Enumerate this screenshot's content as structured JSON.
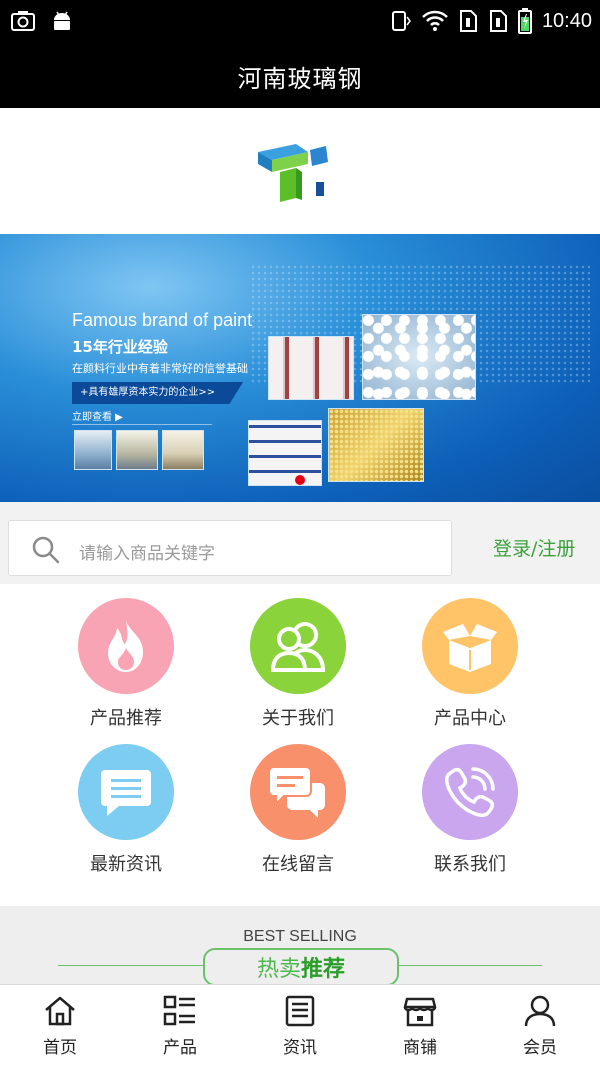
{
  "status_bar": {
    "time": "10:40"
  },
  "header": {
    "title": "河南玻璃钢"
  },
  "banner": {
    "title": "Famous brand of paint",
    "subtitle": "15年行业经验",
    "line": "在颜料行业中有着非常好的信誉基础",
    "pill": "+具有雄厚资本实力的企业>>",
    "more": "立即查看 ▶"
  },
  "search": {
    "placeholder": "请输入商品关键字",
    "login_label": "登录/注册"
  },
  "menu": [
    {
      "label": "产品推荐",
      "icon": "fire-icon",
      "color": "#f9a4b4"
    },
    {
      "label": "关于我们",
      "icon": "users-icon",
      "color": "#8ad33a"
    },
    {
      "label": "产品中心",
      "icon": "box-icon",
      "color": "#ffc468"
    },
    {
      "label": "最新资讯",
      "icon": "message-icon",
      "color": "#7dcdf2"
    },
    {
      "label": "在线留言",
      "icon": "chat-icon",
      "color": "#f7906b"
    },
    {
      "label": "联系我们",
      "icon": "phone-icon",
      "color": "#c9a6ee"
    }
  ],
  "best_selling": {
    "en": "BEST SELLING",
    "cn_part1": "热卖",
    "cn_part2": "推荐"
  },
  "tabbar": [
    {
      "label": "首页",
      "icon": "home-icon"
    },
    {
      "label": "产品",
      "icon": "list-icon"
    },
    {
      "label": "资讯",
      "icon": "news-icon"
    },
    {
      "label": "商铺",
      "icon": "store-icon"
    },
    {
      "label": "会员",
      "icon": "user-icon"
    }
  ]
}
